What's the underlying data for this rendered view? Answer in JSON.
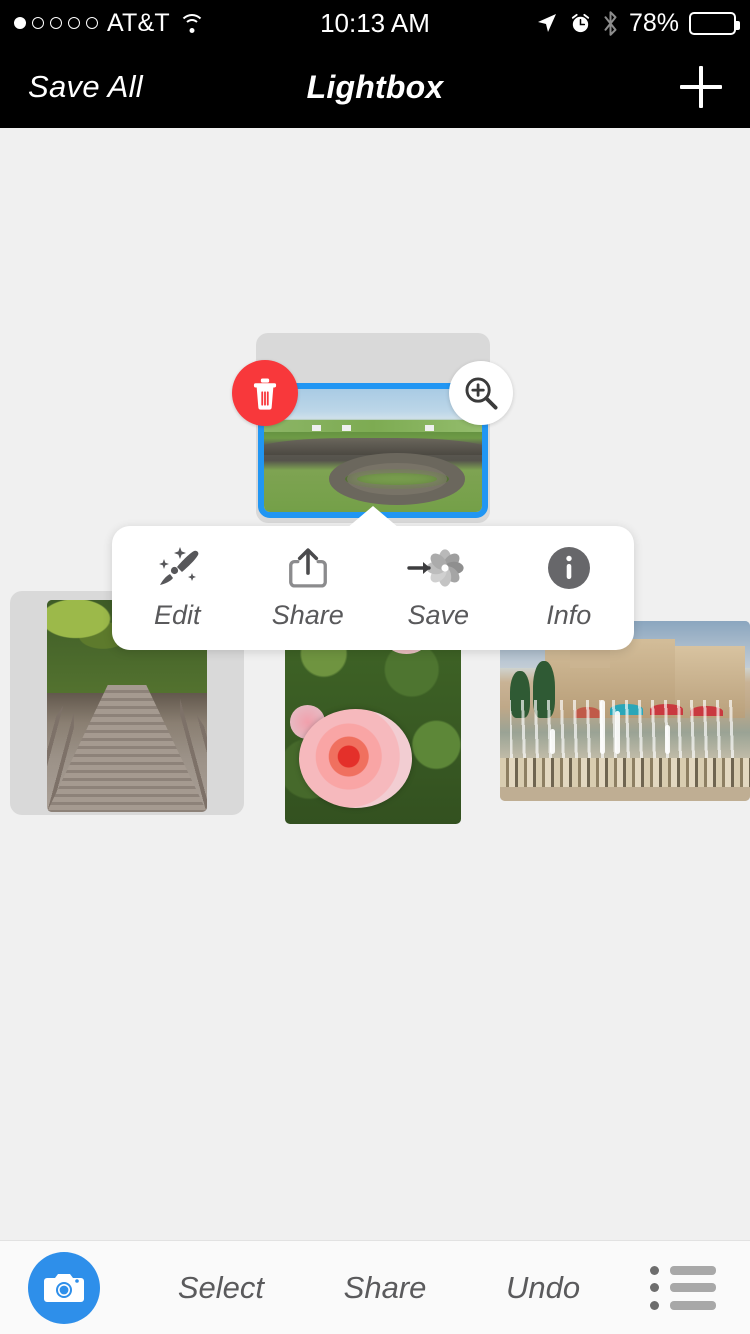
{
  "status_bar": {
    "carrier": "AT&T",
    "signal_dots_total": 5,
    "signal_dots_filled": 1,
    "wifi_icon": "wifi-icon",
    "time": "10:13 AM",
    "location_icon": "location-arrow-icon",
    "alarm_icon": "alarm-clock-icon",
    "bluetooth_icon": "bluetooth-icon",
    "battery_percent": "78%",
    "battery_level": 78
  },
  "nav_bar": {
    "left_button": "Save All",
    "title": "Lightbox",
    "right_icon": "plus-icon"
  },
  "selected_photo": {
    "description": "stone ringfort in green irish fields",
    "selection_color": "#2196F3",
    "delete_icon": "trash-icon",
    "delete_color": "#F8383B",
    "zoom_icon": "magnifier-plus-icon"
  },
  "popup_menu": {
    "items": [
      {
        "label": "Edit",
        "icon": "paintbrush-sparkle-icon"
      },
      {
        "label": "Share",
        "icon": "share-upload-icon"
      },
      {
        "label": "Save",
        "icon": "save-to-photos-flower-icon"
      },
      {
        "label": "Info",
        "icon": "info-circle-icon"
      }
    ]
  },
  "thumbnails": [
    {
      "description": "wooden boardwalk through green forest"
    },
    {
      "description": "pink roses in a garden"
    },
    {
      "description": "spanish colonial building with fountain and umbrellas"
    }
  ],
  "toolbar": {
    "camera_icon": "camera-icon",
    "camera_color": "#2E8FEA",
    "links": [
      "Select",
      "Share",
      "Undo"
    ],
    "list_icon": "bulleted-list-icon"
  },
  "colors": {
    "background": "#f0f0f0",
    "card": "#d9d9d9",
    "nav_background": "#000000",
    "toolbar_background": "#fafafa",
    "text_gray": "#5a5a5c"
  }
}
